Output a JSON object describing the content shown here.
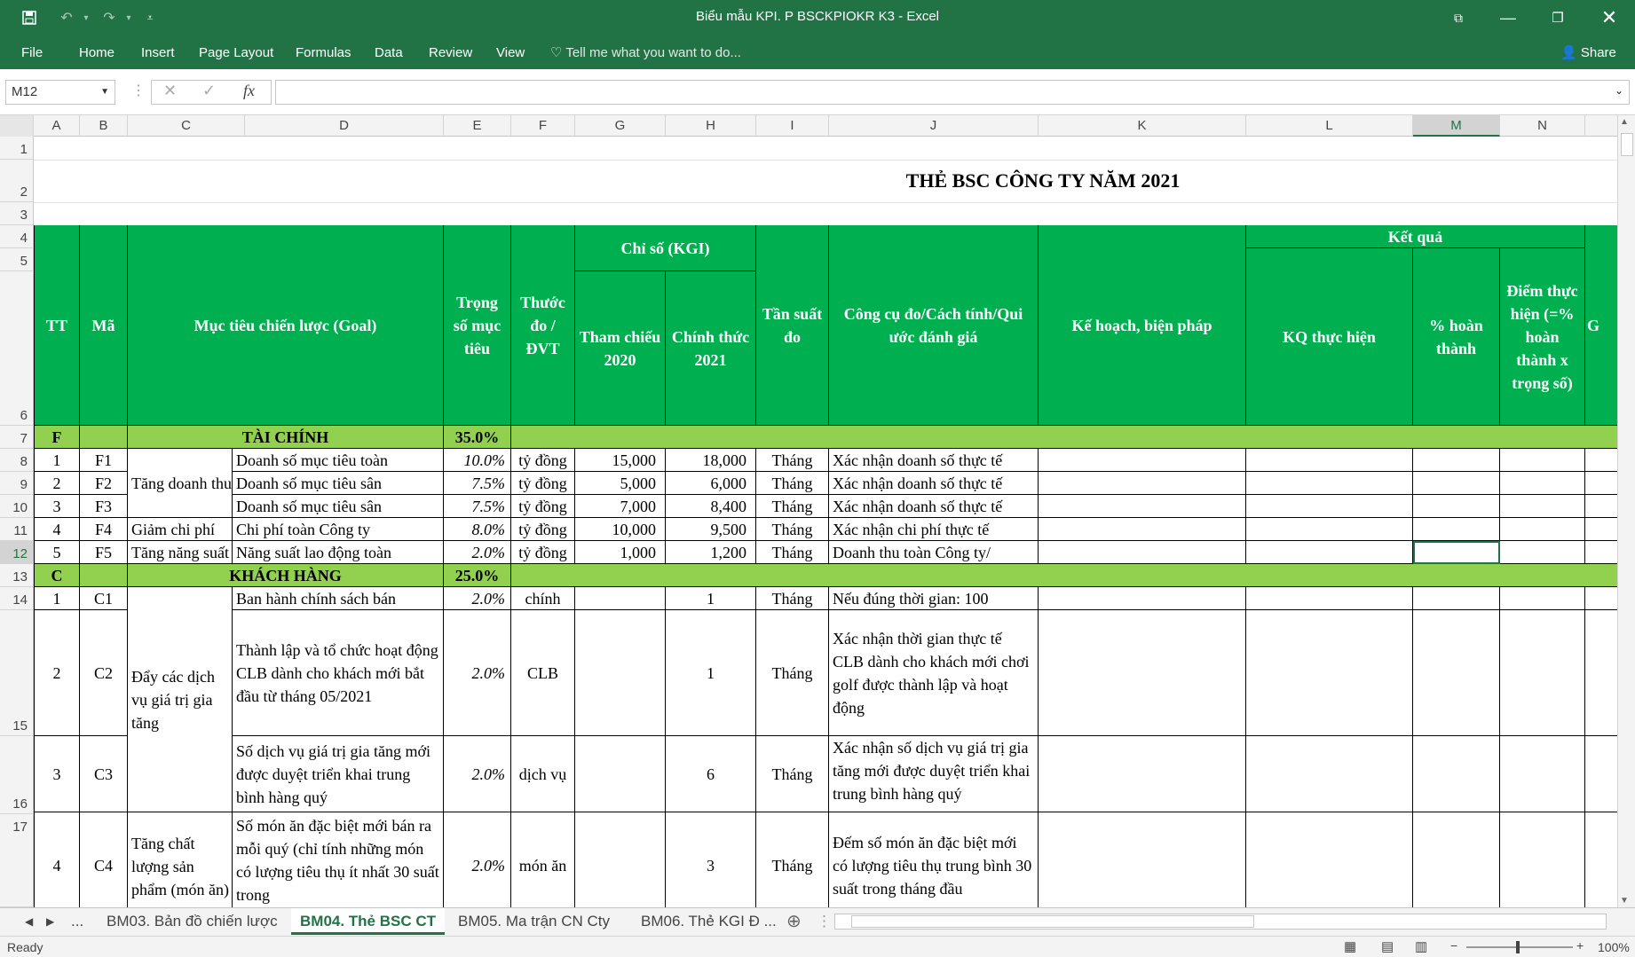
{
  "window": {
    "title": "Biểu mẫu KPI. P BSCKPIOKR K3 - Excel",
    "share_label": "Share"
  },
  "ribbon": {
    "tabs": [
      "File",
      "Home",
      "Insert",
      "Page Layout",
      "Formulas",
      "Data",
      "Review",
      "View"
    ],
    "tell_me": "Tell me what you want to do..."
  },
  "formula_bar": {
    "name_box": "M12",
    "fx": "fx",
    "value": ""
  },
  "columns": [
    "A",
    "B",
    "C",
    "D",
    "E",
    "F",
    "G",
    "H",
    "I",
    "J",
    "K",
    "L",
    "M",
    "N"
  ],
  "selected_column": "M",
  "rows": [
    "1",
    "2",
    "3",
    "4",
    "5",
    "6",
    "7",
    "8",
    "9",
    "10",
    "11",
    "12",
    "13",
    "14",
    "15",
    "16",
    "17"
  ],
  "selected_row": "12",
  "sheet": {
    "title": "THẺ BSC CÔNG TY NĂM 2021",
    "headers": {
      "tt": "TT",
      "ma": "Mã",
      "goal": "Mục tiêu chiến lược (Goal)",
      "weight": "Trọng số mục tiêu",
      "unit": "Thước đo /ĐVT",
      "kgi": "Chỉ số (KGI)",
      "ref2020": "Tham chiếu 2020",
      "official2021": "Chính thức 2021",
      "freq": "Tần suất đo",
      "tool": "Công cụ đo/Cách tính/Qui ước đánh giá",
      "plan": "Kế hoạch, biện pháp",
      "result": "Kết quả",
      "kq": "KQ thực hiện",
      "pct": "% hoàn thành",
      "score": "Điểm thực hiện (=% hoàn thành x trọng số)",
      "overflow": "G"
    },
    "bands": {
      "finance": {
        "code": "F",
        "label": "TÀI CHÍNH",
        "weight": "35.0%"
      },
      "customer": {
        "code": "C",
        "label": "KHÁCH HÀNG",
        "weight": "25.0%"
      }
    },
    "finance_rows": [
      {
        "tt": "1",
        "ma": "F1",
        "measure": "Doanh số mục tiêu toàn",
        "weight": "10.0%",
        "unit": "tỷ đồng",
        "ref": "15,000",
        "off": "18,000",
        "freq": "Tháng",
        "tool": "Xác nhận doanh số thực tế"
      },
      {
        "tt": "2",
        "ma": "F2",
        "measure": "Doanh số mục tiêu sân",
        "weight": "7.5%",
        "unit": "tỷ đồng",
        "ref": "5,000",
        "off": "6,000",
        "freq": "Tháng",
        "tool": "Xác nhận doanh số thực tế"
      },
      {
        "tt": "3",
        "ma": "F3",
        "measure": "Doanh số mục tiêu sân",
        "weight": "7.5%",
        "unit": "tỷ đồng",
        "ref": "7,000",
        "off": "8,400",
        "freq": "Tháng",
        "tool": "Xác nhận doanh số thực tế"
      },
      {
        "tt": "4",
        "ma": "F4",
        "measure": "Chi phí toàn Công ty",
        "weight": "8.0%",
        "unit": "tỷ đồng",
        "ref": "10,000",
        "off": "9,500",
        "freq": "Tháng",
        "tool": "Xác nhận chi phí thực tế"
      },
      {
        "tt": "5",
        "ma": "F5",
        "measure": "Năng suất lao động toàn",
        "weight": "2.0%",
        "unit": "tỷ đồng",
        "ref": "1,000",
        "off": "1,200",
        "freq": "Tháng",
        "tool": "Doanh thu toàn Công ty/"
      }
    ],
    "finance_goals": {
      "g1": "Tăng doanh thu",
      "g2": "Giảm chi phí",
      "g3": "Tăng năng suất"
    },
    "customer_rows": [
      {
        "tt": "1",
        "ma": "C1",
        "measure": "Ban hành chính sách bán",
        "weight": "2.0%",
        "unit": "chính",
        "ref": "",
        "off": "1",
        "freq": "Tháng",
        "tool": "Nếu đúng thời gian: 100"
      },
      {
        "tt": "2",
        "ma": "C2",
        "measure": "Thành lập và tổ chức hoạt động CLB dành cho khách mới bắt đầu từ tháng 05/2021",
        "weight": "2.0%",
        "unit": "CLB",
        "ref": "",
        "off": "1",
        "freq": "Tháng",
        "tool": "Xác nhận thời gian thực tế CLB dành cho khách mới chơi golf được thành lập và hoạt động"
      },
      {
        "tt": "3",
        "ma": "C3",
        "measure": "Số dịch vụ giá trị gia tăng mới được duyệt triển khai trung bình hàng quý",
        "weight": "2.0%",
        "unit": "dịch vụ",
        "ref": "",
        "off": "6",
        "freq": "Tháng",
        "tool": "Xác nhận số dịch vụ giá trị gia tăng mới được duyệt triển khai trung bình hàng quý"
      },
      {
        "tt": "4",
        "ma": "C4",
        "measure": "Số món ăn đặc biệt mới bán ra mỗi quý (chỉ tính những món có lượng tiêu thụ ít nhất 30 suất trong",
        "weight": "2.0%",
        "unit": "món ăn",
        "ref": "",
        "off": "3",
        "freq": "Tháng",
        "tool": "Đếm số món ăn đặc biệt mới có lượng tiêu thụ trung bình 30 suất trong tháng đầu"
      }
    ],
    "customer_goals": {
      "g1": "Đẩy các dịch vụ giá trị gia tăng",
      "g2": "Tăng chất lượng sản phẩm (món ăn)"
    }
  },
  "sheet_tabs": [
    "...",
    "BM03. Bản đồ chiến lược",
    "BM04. Thẻ BSC CT",
    "BM05. Ma trận CN Cty",
    "BM06. Thẻ KGI Đ ..."
  ],
  "active_sheet": "BM04. Thẻ BSC CT",
  "status": {
    "ready": "Ready",
    "zoom": "100%"
  },
  "colors": {
    "excel_green": "#217346",
    "header_green": "#00b050",
    "band_green": "#92d050"
  }
}
